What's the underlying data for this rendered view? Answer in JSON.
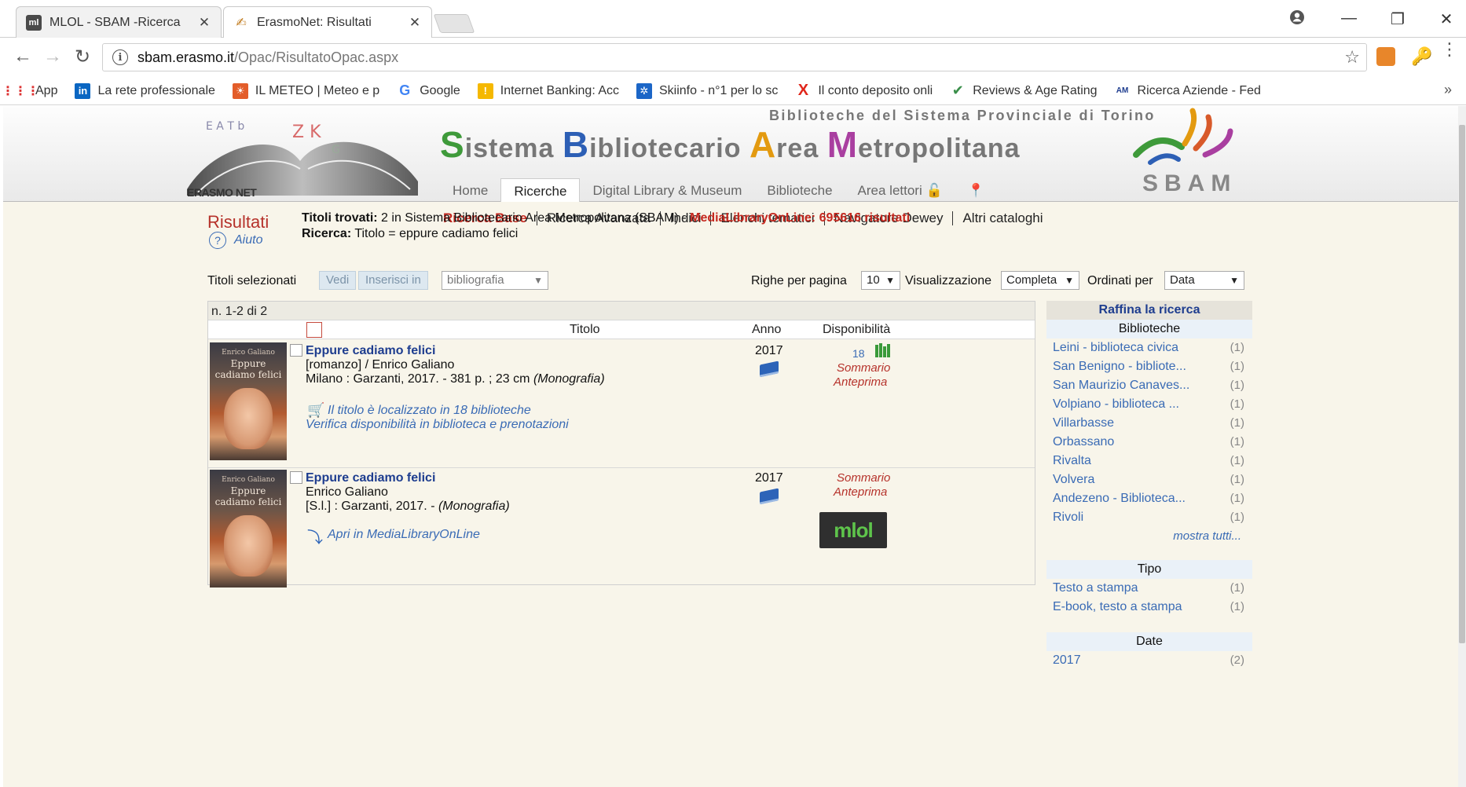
{
  "browser": {
    "tabs": [
      {
        "title": "MLOL - SBAM -Ricerca",
        "icon": "mlol-favicon",
        "active": false
      },
      {
        "title": "ErasmoNet: Risultati",
        "icon": "erasmonet-favicon",
        "active": true
      }
    ],
    "url_domain": "sbam.erasmo.it",
    "url_path": "/Opac/RisultatoOpac.aspx",
    "bookmarks": [
      {
        "label": "App",
        "icon": "apps-grid-icon"
      },
      {
        "label": "La rete professionale",
        "icon": "linkedin-icon"
      },
      {
        "label": "IL METEO | Meteo e p",
        "icon": "meteo-icon"
      },
      {
        "label": "Google",
        "icon": "google-icon"
      },
      {
        "label": "Internet Banking: Acc",
        "icon": "bank-icon"
      },
      {
        "label": "Skiinfo - n°1 per lo sc",
        "icon": "skiinfo-icon"
      },
      {
        "label": "Il conto deposito onli",
        "icon": "x-brand-icon"
      },
      {
        "label": "Reviews & Age Rating",
        "icon": "check-circle-icon"
      },
      {
        "label": "Ricerca Aziende - Fed",
        "icon": "aziende-icon"
      }
    ],
    "more_bookmarks": "»"
  },
  "site": {
    "subtitle": "Biblioteche del Sistema Provinciale di Torino",
    "title_parts": [
      {
        "cap": "S",
        "rest": "istema"
      },
      {
        "cap": "B",
        "rest": "ibliotecario"
      },
      {
        "cap": "A",
        "rest": "rea"
      },
      {
        "cap": "M",
        "rest": "etropolitana"
      }
    ],
    "erasmo_label": "ERASMO NET",
    "sbam_label": "SBAM",
    "nav": [
      "Home",
      "Ricerche",
      "Digital Library & Museum",
      "Biblioteche",
      "Area lettori"
    ],
    "nav_active": "Ricerche",
    "subnav": [
      "Ricerca Base",
      "Ricerca Avanzata",
      "Indici",
      "Elenchi tematici",
      "Navigatore Dewey",
      "Altri cataloghi"
    ],
    "subnav_active": "Ricerca Base"
  },
  "results_header": {
    "title": "Risultati",
    "help": "Aiuto",
    "found_label": "Titoli trovati:",
    "found_text": "2 in Sistema Bibliotecario Area Metropolitana (SBAM) -",
    "mlol_text": "MediaLibraryOnLine: 695616 risultati",
    "search_label": "Ricerca:",
    "search_text": "Titolo = eppure cadiamo felici"
  },
  "toolbar": {
    "selected_label": "Titoli selezionati",
    "view_button": "Vedi",
    "insert_button": "Inserisci in",
    "target_select": "bibliografia",
    "rows_label": "Righe per pagina",
    "rows_value": "10",
    "display_label": "Visualizzazione",
    "display_value": "Completa",
    "sort_label": "Ordinati per",
    "sort_value": "Data"
  },
  "results": {
    "count": "n. 1-2 di 2",
    "columns": {
      "title": "Titolo",
      "year": "Anno",
      "availability": "Disponibilità"
    },
    "records": [
      {
        "title": "Eppure cadiamo felici",
        "line1": "[romanzo] / Enrico Galiano",
        "line2": "Milano : Garzanti, 2017. - 381 p. ; 23 cm",
        "type": "(Monografia)",
        "located": "Il titolo è localizzato in 18 biblioteche",
        "verify": "Verifica disponibilità in biblioteca e prenotazioni",
        "year": "2017",
        "libraries": "18",
        "summary": "Sommario",
        "preview": "Anteprima",
        "cover_author": "Enrico Galiano",
        "cover_title": "Eppure cadiamo felici"
      },
      {
        "title": "Eppure cadiamo felici",
        "line1": "Enrico Galiano",
        "line2": "[S.l.] : Garzanti, 2017. -",
        "type": "(Monografia)",
        "open_mlol": "Apri in MediaLibraryOnLine",
        "year": "2017",
        "summary": "Sommario",
        "preview": "Anteprima",
        "mlol_badge": "mlol",
        "cover_author": "Enrico Galiano",
        "cover_title": "Eppure cadiamo felici"
      }
    ]
  },
  "refine": {
    "title": "Raffina la ricerca",
    "libraries_header": "Biblioteche",
    "libraries": [
      {
        "name": "Leini - biblioteca civica",
        "count": "(1)"
      },
      {
        "name": "San Benigno - bibliote...",
        "count": "(1)"
      },
      {
        "name": "San Maurizio Canaves...",
        "count": "(1)"
      },
      {
        "name": "Volpiano - biblioteca ...",
        "count": "(1)"
      },
      {
        "name": "Villarbasse",
        "count": "(1)"
      },
      {
        "name": "Orbassano",
        "count": "(1)"
      },
      {
        "name": "Rivalta",
        "count": "(1)"
      },
      {
        "name": "Volvera",
        "count": "(1)"
      },
      {
        "name": "Andezeno - Biblioteca...",
        "count": "(1)"
      },
      {
        "name": "Rivoli",
        "count": "(1)"
      }
    ],
    "show_all": "mostra tutti...",
    "type_header": "Tipo",
    "types": [
      {
        "name": "Testo a stampa",
        "count": "(1)"
      },
      {
        "name": "E-book, testo a stampa",
        "count": "(1)"
      }
    ],
    "date_header": "Date",
    "dates": [
      {
        "name": "2017",
        "count": "(2)"
      }
    ]
  }
}
